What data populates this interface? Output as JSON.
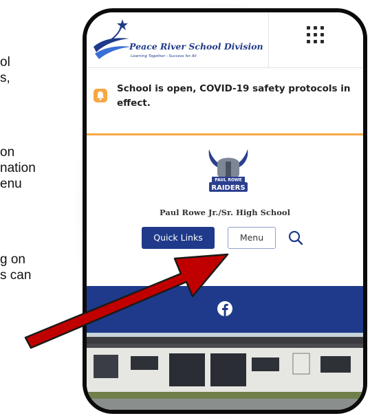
{
  "side_text": {
    "lines": [
      "ol",
      "s,",
      "on",
      "nation",
      "enu",
      "g on",
      "s can"
    ]
  },
  "header": {
    "org_name": "Peace River School Division",
    "org_tagline": "Learning Together - Success for All",
    "apps_icon": "grid-dots-icon"
  },
  "alert": {
    "icon": "bell-icon",
    "message": "School is open, COVID-19 safety protocols in effect.",
    "border_color": "#f5a742"
  },
  "school": {
    "logo_text_top": "PAUL ROWE",
    "logo_text_bottom": "RAIDERS",
    "name": "Paul Rowe Jr./Sr. High School"
  },
  "nav": {
    "quick_links_label": "Quick Links",
    "menu_label": "Menu",
    "search_icon": "search-icon"
  },
  "social": {
    "icon": "facebook-icon",
    "band_color": "#1f3a8a"
  },
  "colors": {
    "accent": "#1f3a8a",
    "alert": "#f5a742",
    "arrow": "#c00000"
  }
}
